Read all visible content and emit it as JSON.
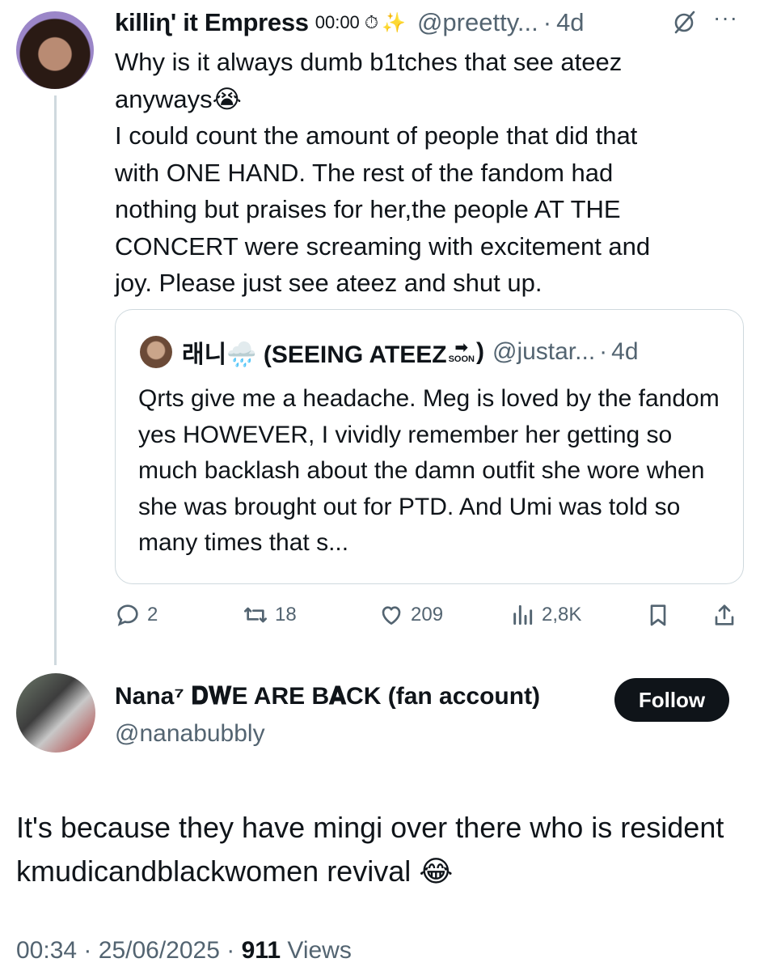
{
  "parent": {
    "name": "killiɳ' it Empress",
    "badge": "00:00 ⏱",
    "sparkle": "✨",
    "handle": "@preetty...",
    "dot": "·",
    "time": "4d",
    "more": "···",
    "text": "Why is it always dumb b1tches that see ateez\nanyways😭\nI could count the amount of people that did that\nwith ONE HAND. The rest of the fandom had\nnothing but praises for her,the people AT THE\nCONCERT were screaming with excitement and\njoy. Please just see ateez and shut up.",
    "grok_icon": "grok-icon",
    "more_icon": "more-icon"
  },
  "quote": {
    "name": "래니🌧️ (SEEING ATEEZ ",
    "soon_arrow": "➡",
    "soon_label": "SOON",
    "name_close": ")",
    "handle": "@justar...",
    "dot": "·",
    "time": "4d",
    "text": "Qrts give me a headache. Meg is loved by the fandom yes HOWEVER, I vividly remember her getting so much backlash about the damn outfit she wore when she was brought out for PTD. And Umi was told so many times that s..."
  },
  "actions": {
    "replies": "2",
    "reposts": "18",
    "likes": "209",
    "views": "2,8K",
    "icons": [
      "reply-icon",
      "repost-icon",
      "like-icon",
      "views-icon",
      "bookmark-icon",
      "share-icon"
    ]
  },
  "reply": {
    "name": "Nana⁷ 𝐃𝐖E ARE B𝐀CK (fan account)",
    "handle": "@nanabubbly",
    "follow_label": "Follow",
    "text": "It's because they have mingi over there who is resident kmudicandblackwomen revival 😂",
    "time": "00:34",
    "dot1": "·",
    "date": "25/06/2025",
    "dot2": "·",
    "views_count": "911",
    "views_label": " Views"
  },
  "colors": {
    "text": "#0f1419",
    "secondary": "#536471",
    "border": "#cfd9de",
    "follow_bg": "#0f1419"
  }
}
